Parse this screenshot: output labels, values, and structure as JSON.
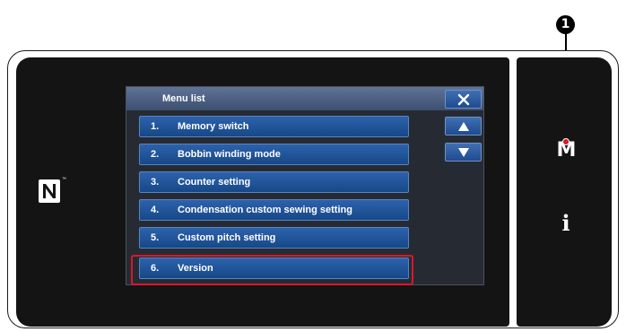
{
  "callout": {
    "number": "1"
  },
  "side_keys": {
    "menu_key": "M",
    "info_key": "i"
  },
  "nfc": {
    "trademark": "™"
  },
  "screen": {
    "title": "Menu list",
    "close_icon": "close-icon",
    "scroll_up_icon": "triangle-up-icon",
    "scroll_down_icon": "triangle-down-icon",
    "menu_items": [
      {
        "number": "1.",
        "label": "Memory switch"
      },
      {
        "number": "2.",
        "label": "Bobbin winding mode"
      },
      {
        "number": "3.",
        "label": "Counter setting"
      },
      {
        "number": "4.",
        "label": "Condensation custom sewing setting"
      },
      {
        "number": "5.",
        "label": "Custom pitch setting"
      },
      {
        "number": "6.",
        "label": "Version"
      }
    ]
  },
  "colors": {
    "highlight": "#d8182a",
    "button_blue": "#2c62ac",
    "header_blue": "#5f7397",
    "panel_dark": "#141414"
  }
}
